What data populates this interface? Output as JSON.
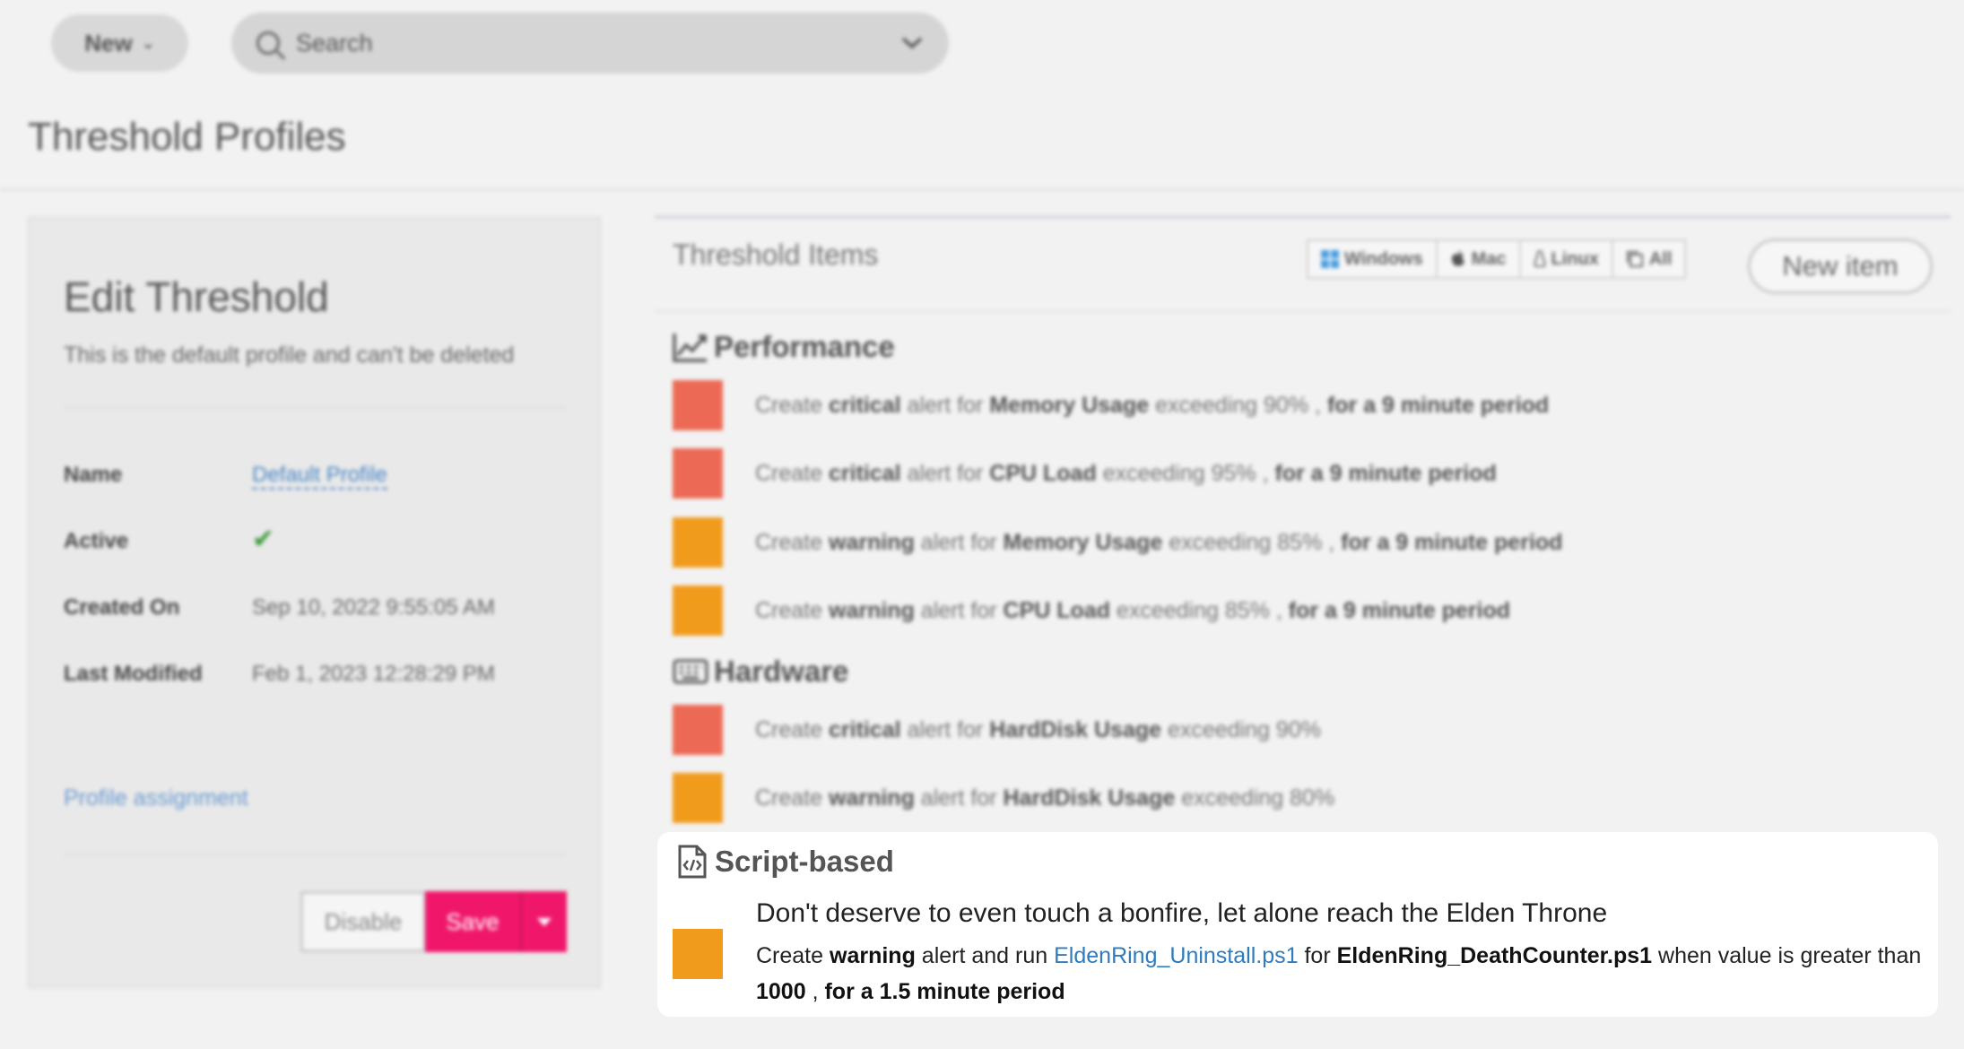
{
  "toolbar": {
    "new_label": "New",
    "new_chevron": "⌄",
    "search_placeholder": "Search"
  },
  "page_title": "Threshold Profiles",
  "edit_card": {
    "title": "Edit Threshold",
    "subtitle": "This is the default profile and can't be deleted",
    "fields": [
      {
        "label": "Name",
        "value": "Default Profile"
      },
      {
        "label": "Active",
        "value": "✔"
      },
      {
        "label": "Created On",
        "value": "Sep 10, 2022 9:55:05 AM"
      },
      {
        "label": "Last Modified",
        "value": "Feb 1, 2023 12:28:29 PM"
      }
    ],
    "assignment_link": "Profile assignment",
    "disable_label": "Disable",
    "save_label": "Save"
  },
  "items_panel": {
    "title": "Threshold Items",
    "os_filters": [
      "Windows",
      "Mac",
      "Linux",
      "All"
    ],
    "new_item_label": "New item",
    "sections": {
      "performance": {
        "name": "Performance",
        "items": [
          {
            "level": "critical",
            "metric": "Memory Usage",
            "threshold": "90%",
            "period": "for a 9 minute period"
          },
          {
            "level": "critical",
            "metric": "CPU Load",
            "threshold": "95%",
            "period": "for a 9 minute period"
          },
          {
            "level": "warning",
            "metric": "Memory Usage",
            "threshold": "85%",
            "period": "for a 9 minute period"
          },
          {
            "level": "warning",
            "metric": "CPU Load",
            "threshold": "85%",
            "period": "for a 9 minute period"
          }
        ]
      },
      "hardware": {
        "name": "Hardware",
        "items": [
          {
            "level": "critical",
            "metric": "HardDisk Usage",
            "threshold": "90%"
          },
          {
            "level": "warning",
            "metric": "HardDisk Usage",
            "threshold": "80%"
          }
        ]
      },
      "script": {
        "name": "Script-based",
        "title": "Don't deserve to even touch a bonfire, let alone reach the Elden Throne",
        "level": "warning",
        "run_script": "EldenRing_Uninstall.ps1",
        "source_script": "EldenRing_DeathCounter.ps1",
        "value": "1000",
        "period": "for a 1.5 minute period"
      }
    },
    "text": {
      "create": "Create",
      "alert_for": "alert for",
      "exceeding": "exceeding",
      "alert_and_run": "alert and run",
      "for": "for",
      "when_greater": "when value is greater than",
      "comma": ","
    }
  },
  "colors": {
    "critical": "#ec6a55",
    "warning": "#f19b1d",
    "save": "#f0176b",
    "link": "#2e7bbf"
  }
}
